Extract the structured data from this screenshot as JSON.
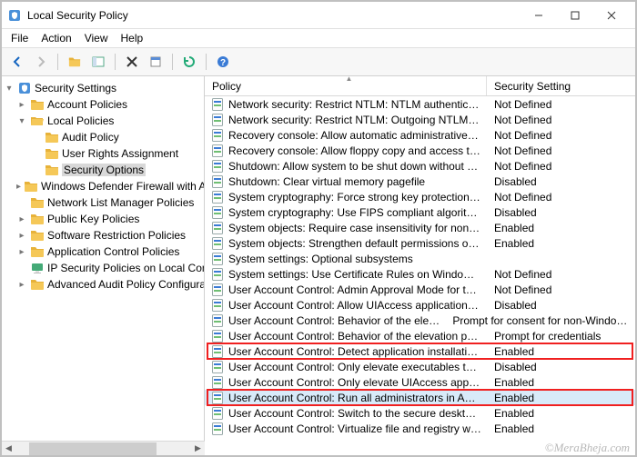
{
  "window": {
    "title": "Local Security Policy"
  },
  "menu": {
    "file": "File",
    "action": "Action",
    "view": "View",
    "help": "Help"
  },
  "tree": {
    "root": "Security Settings",
    "items": {
      "account_policies": "Account Policies",
      "local_policies": "Local Policies",
      "audit_policy": "Audit Policy",
      "user_rights": "User Rights Assignment",
      "security_options": "Security Options",
      "wdf": "Windows Defender Firewall with Advanced Security",
      "nlmp": "Network List Manager Policies",
      "pkp": "Public Key Policies",
      "srp": "Software Restriction Policies",
      "acp": "Application Control Policies",
      "ipsec": "IP Security Policies on Local Computer",
      "aapc": "Advanced Audit Policy Configuration"
    }
  },
  "list": {
    "headers": {
      "policy": "Policy",
      "setting": "Security Setting"
    },
    "rows": [
      {
        "name": "Network security: Restrict NTLM: NTLM authentication in this domain",
        "value": "Not Defined"
      },
      {
        "name": "Network security: Restrict NTLM: Outgoing NTLM traffic to remote servers",
        "value": "Not Defined"
      },
      {
        "name": "Recovery console: Allow automatic administrative logon",
        "value": "Not Defined"
      },
      {
        "name": "Recovery console: Allow floppy copy and access to all drives and all folders",
        "value": "Not Defined"
      },
      {
        "name": "Shutdown: Allow system to be shut down without having to log on",
        "value": "Not Defined"
      },
      {
        "name": "Shutdown: Clear virtual memory pagefile",
        "value": "Disabled"
      },
      {
        "name": "System cryptography: Force strong key protection for user keys stored on the computer",
        "value": "Not Defined"
      },
      {
        "name": "System cryptography: Use FIPS compliant algorithms for encryption, hashing, and signing",
        "value": "Disabled"
      },
      {
        "name": "System objects: Require case insensitivity for non-Windows subsystems",
        "value": "Enabled"
      },
      {
        "name": "System objects: Strengthen default permissions of internal system objects (e.g. Symbolic Links)",
        "value": "Enabled"
      },
      {
        "name": "System settings: Optional subsystems",
        "value": ""
      },
      {
        "name": "System settings: Use Certificate Rules on Windows Executables for Software Restriction Policies",
        "value": "Not Defined"
      },
      {
        "name": "User Account Control: Admin Approval Mode for the Built-in Administrator account",
        "value": "Not Defined"
      },
      {
        "name": "User Account Control: Allow UIAccess applications to prompt for elevation without using the secure desktop",
        "value": "Disabled"
      },
      {
        "name": "User Account Control: Behavior of the elevation prompt for administrators in Admin Approval Mode",
        "value": "Prompt for consent for non-Windows binaries"
      },
      {
        "name": "User Account Control: Behavior of the elevation prompt for standard users",
        "value": "Prompt for credentials"
      },
      {
        "name": "User Account Control: Detect application installations and prompt for elevation",
        "value": "Enabled",
        "highlight": true
      },
      {
        "name": "User Account Control: Only elevate executables that are signed and validated",
        "value": "Disabled"
      },
      {
        "name": "User Account Control: Only elevate UIAccess applications that are installed in secure locations",
        "value": "Enabled"
      },
      {
        "name": "User Account Control: Run all administrators in Admin Approval Mode",
        "value": "Enabled",
        "highlight": true,
        "selected": true
      },
      {
        "name": "User Account Control: Switch to the secure desktop when prompting for elevation",
        "value": "Enabled"
      },
      {
        "name": "User Account Control: Virtualize file and registry write failures to per-user locations",
        "value": "Enabled"
      }
    ]
  },
  "watermark": "©MeraBheja.com"
}
